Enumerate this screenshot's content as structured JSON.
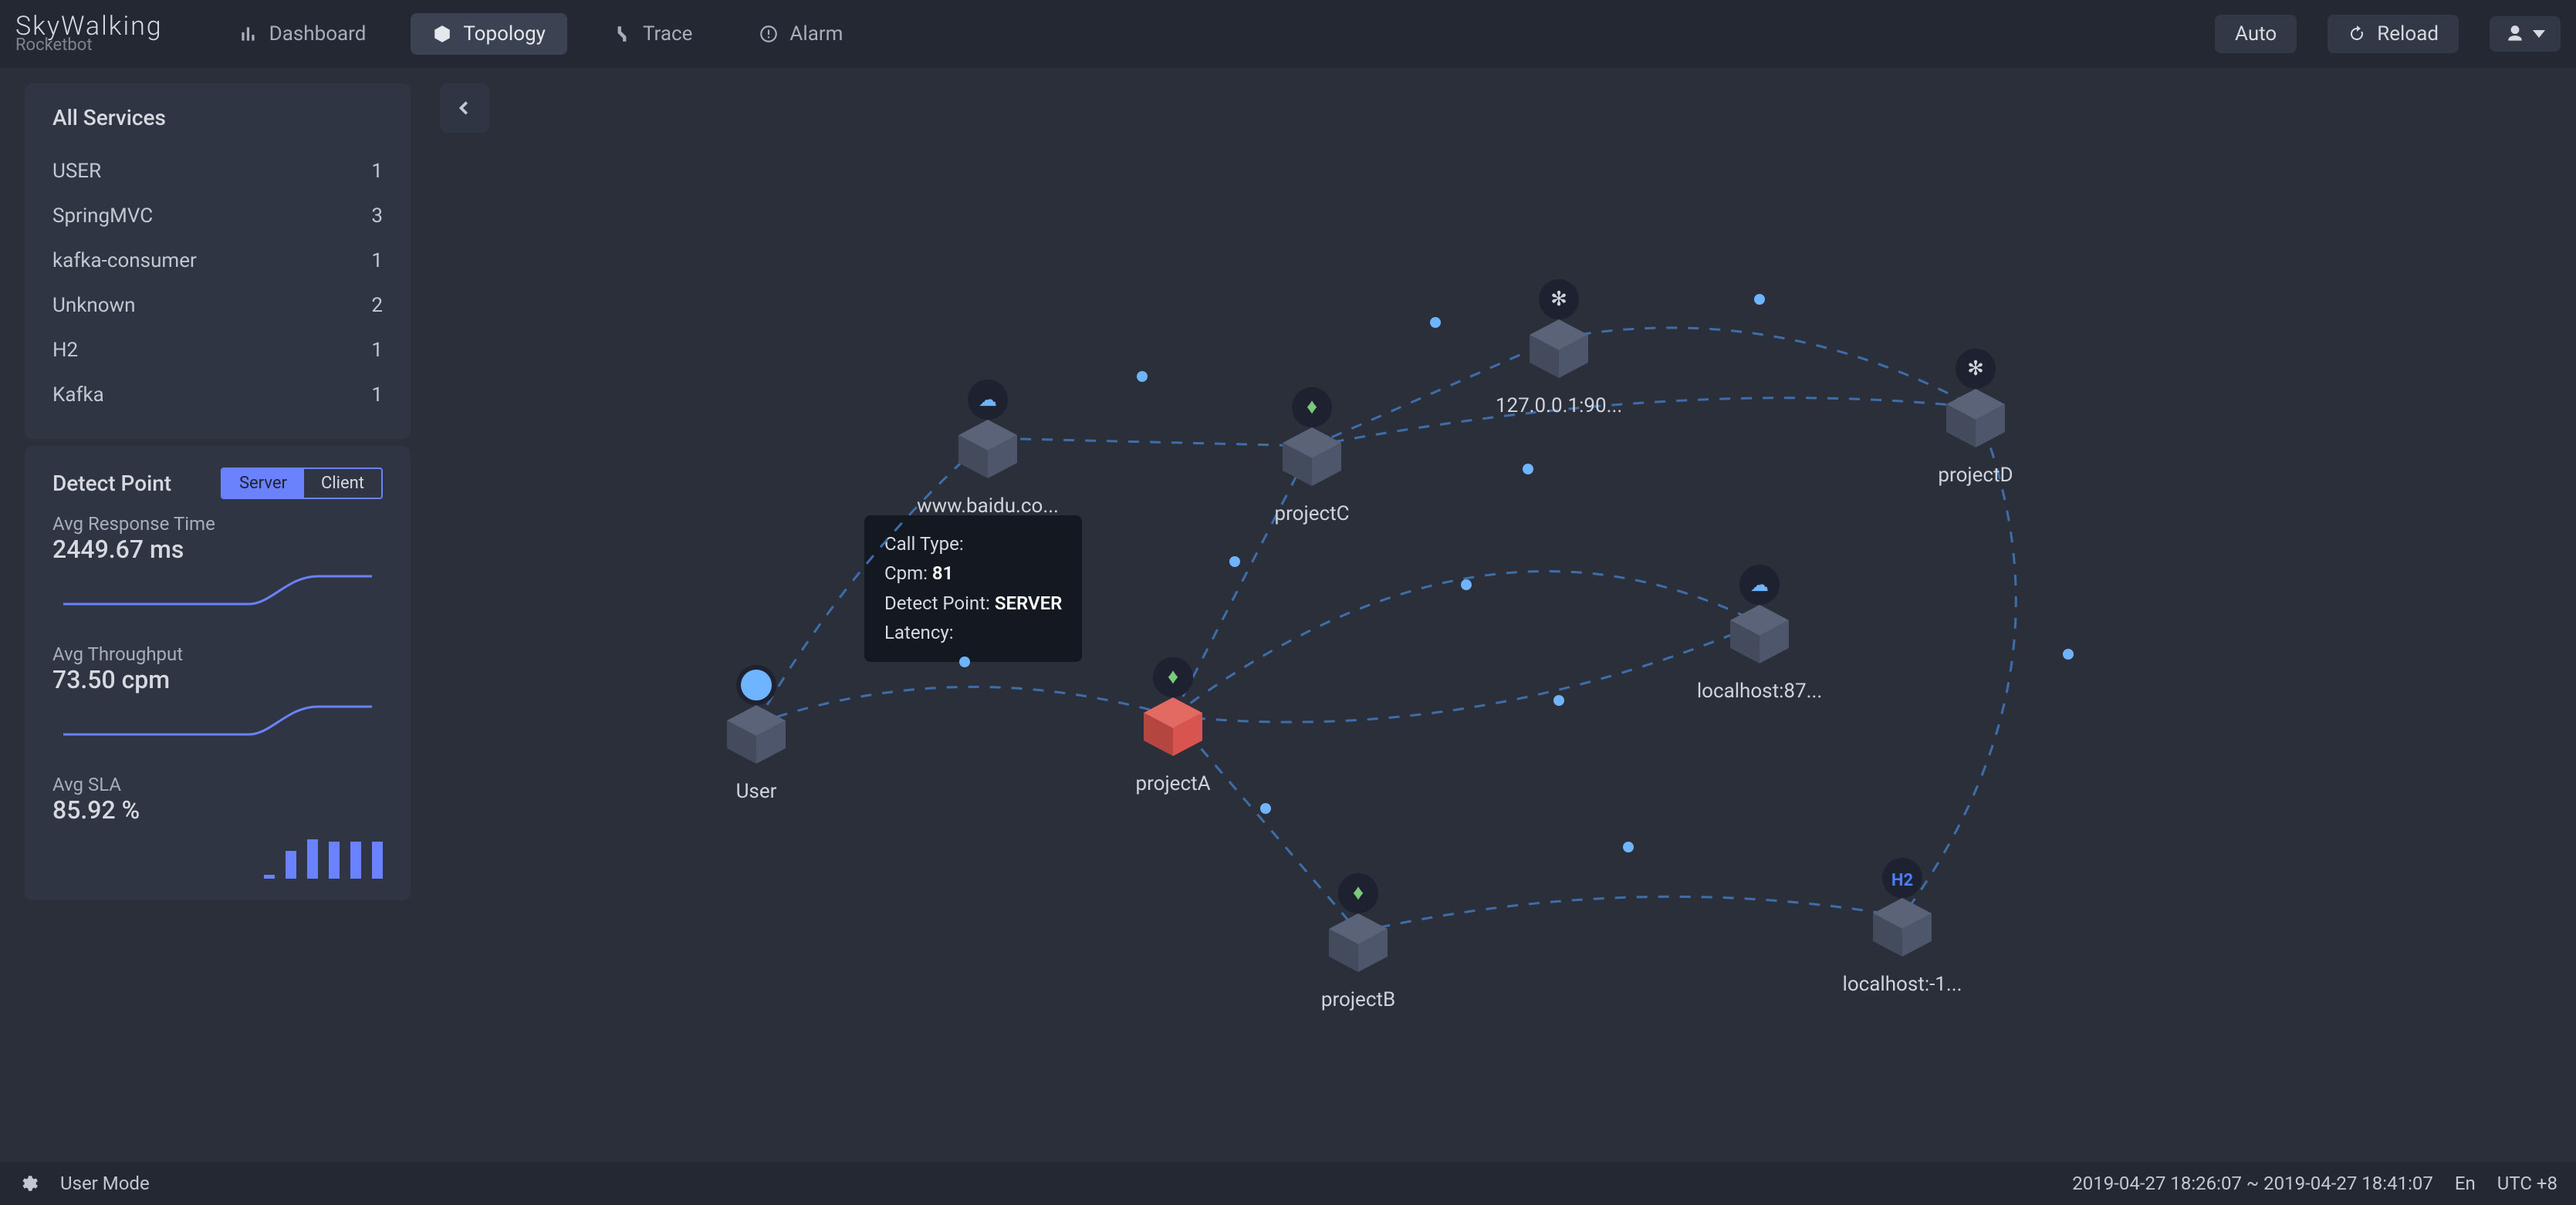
{
  "brand": {
    "main": "SkyWalking",
    "sub": "Rocketbot"
  },
  "nav": {
    "dashboard": "Dashboard",
    "topology": "Topology",
    "trace": "Trace",
    "alarm": "Alarm"
  },
  "top_actions": {
    "auto": "Auto",
    "reload": "Reload"
  },
  "services_panel": {
    "title": "All Services",
    "rows": [
      {
        "name": "USER",
        "count": "1"
      },
      {
        "name": "SpringMVC",
        "count": "3"
      },
      {
        "name": "kafka-consumer",
        "count": "1"
      },
      {
        "name": "Unknown",
        "count": "2"
      },
      {
        "name": "H2",
        "count": "1"
      },
      {
        "name": "Kafka",
        "count": "1"
      }
    ]
  },
  "detect_panel": {
    "title": "Detect Point",
    "tabs": {
      "server": "Server",
      "client": "Client"
    },
    "metrics": {
      "resp": {
        "label": "Avg Response Time",
        "value": "2449.67 ms"
      },
      "thru": {
        "label": "Avg Throughput",
        "value": "73.50 cpm"
      },
      "sla": {
        "label": "Avg SLA",
        "value": "85.92 %"
      }
    }
  },
  "tooltip": {
    "call_type_label": "Call Type:",
    "cpm_label": "Cpm:",
    "cpm_value": "81",
    "dp_label": "Detect Point:",
    "dp_value": "SERVER",
    "latency_label": "Latency:"
  },
  "nodes": {
    "n_12700190": "127.0.0.1:90...",
    "n_projectD": "projectD",
    "n_baidu": "www.baidu.co...",
    "n_projectC": "projectC",
    "n_user": "User",
    "n_projectA": "projectA",
    "n_local87": "localhost:87...",
    "n_projectB": "projectB",
    "n_local1": "localhost:-1..."
  },
  "footer": {
    "user_mode": "User Mode",
    "range": "2019-04-27 18:26:07 ~ 2019-04-27 18:41:07",
    "lang": "En",
    "tz": "UTC +8"
  }
}
